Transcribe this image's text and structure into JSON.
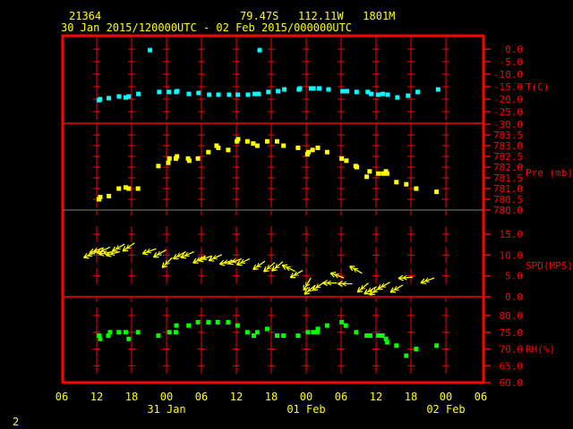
{
  "header": {
    "station": "21364",
    "location": "79.47S   112.11W   1801M",
    "period": "30 Jan 2015/120000UTC - 02 Feb 2015/000000UTC"
  },
  "page_number": "2",
  "colors": {
    "frame": "#ff0000",
    "axis_text": "#ff0000",
    "time_text": "#ffff00",
    "temperature": "#00ffff",
    "pressure": "#ffff00",
    "wind": "#ffff00",
    "humidity": "#00ff00"
  },
  "chart_data": {
    "type": "scatter",
    "year": 2015,
    "x_axis": {
      "range": [
        "30 Jan 06:00",
        "02 Feb 06:00"
      ],
      "tick_labels": [
        "06",
        "12",
        "18",
        "00",
        "06",
        "12",
        "18",
        "00",
        "06",
        "12",
        "18",
        "00",
        "06"
      ],
      "date_labels": [
        {
          "label": "31 Jan",
          "at": "31 Jan 00:00"
        },
        {
          "label": "01 Feb",
          "at": "01 Feb 00:00"
        },
        {
          "label": "02 Feb",
          "at": "02 Feb 00:00"
        }
      ]
    },
    "panels": [
      {
        "id": "temperature",
        "ylabel": "T(C)",
        "ylim": [
          -30,
          0
        ],
        "color": "#00ffff",
        "ticks": [
          "0.0",
          "-5.0",
          "-10.0",
          "-15.0",
          "-20.0",
          "-25.0",
          "-30.0"
        ],
        "points": [
          [
            "30 Jan 12:25",
            -20.4
          ],
          [
            "30 Jan 12:35",
            -20.0
          ],
          [
            "30 Jan 14:05",
            -19.6
          ],
          [
            "30 Jan 15:50",
            -18.9
          ],
          [
            "30 Jan 17:00",
            -19.3
          ],
          [
            "30 Jan 17:30",
            -18.9
          ],
          [
            "30 Jan 19:10",
            -17.9
          ],
          [
            "30 Jan 21:10",
            -0.4
          ],
          [
            "30 Jan 22:45",
            -17.1
          ],
          [
            "31 Jan 00:25",
            -17.1
          ],
          [
            "31 Jan 01:40",
            -17.1
          ],
          [
            "31 Jan 01:50",
            -16.8
          ],
          [
            "31 Jan 03:50",
            -17.9
          ],
          [
            "31 Jan 05:30",
            -17.5
          ],
          [
            "31 Jan 07:20",
            -18.2
          ],
          [
            "31 Jan 08:55",
            -18.2
          ],
          [
            "31 Jan 10:45",
            -18.2
          ],
          [
            "31 Jan 12:15",
            -18.2
          ],
          [
            "31 Jan 14:00",
            -18.2
          ],
          [
            "31 Jan 15:10",
            -17.9
          ],
          [
            "31 Jan 15:50",
            -17.9
          ],
          [
            "31 Jan 16:00",
            -0.4
          ],
          [
            "31 Jan 17:30",
            -17.1
          ],
          [
            "31 Jan 19:10",
            -16.8
          ],
          [
            "31 Jan 20:15",
            -16.1
          ],
          [
            "31 Jan 22:45",
            -16.1
          ],
          [
            "31 Jan 22:55",
            -15.7
          ],
          [
            "01 Feb 00:50",
            -15.7
          ],
          [
            "01 Feb 01:15",
            -15.7
          ],
          [
            "01 Feb 02:15",
            -15.7
          ],
          [
            "01 Feb 03:50",
            -16.1
          ],
          [
            "01 Feb 06:15",
            -16.8
          ],
          [
            "01 Feb 07:00",
            -16.8
          ],
          [
            "01 Feb 08:40",
            -17.1
          ],
          [
            "01 Feb 10:35",
            -17.1
          ],
          [
            "01 Feb 11:10",
            -17.9
          ],
          [
            "01 Feb 12:25",
            -18.2
          ],
          [
            "01 Feb 13:10",
            -17.9
          ],
          [
            "01 Feb 14:00",
            -18.2
          ],
          [
            "01 Feb 15:40",
            -19.3
          ],
          [
            "01 Feb 17:30",
            -18.6
          ],
          [
            "01 Feb 19:10",
            -17.1
          ],
          [
            "01 Feb 22:40",
            -16.1
          ]
        ]
      },
      {
        "id": "pressure",
        "ylabel": "Pre (mb)",
        "ylim": [
          780,
          783.5
        ],
        "color": "#ffff00",
        "ticks": [
          "783.5",
          "783.0",
          "782.5",
          "782.0",
          "781.5",
          "781.0",
          "780.5",
          "780.0"
        ],
        "points": [
          [
            "30 Jan 12:24",
            780.5
          ],
          [
            "30 Jan 12:36",
            780.6
          ],
          [
            "30 Jan 14:06",
            780.65
          ],
          [
            "30 Jan 15:48",
            781.0
          ],
          [
            "30 Jan 17:00",
            781.05
          ],
          [
            "30 Jan 17:30",
            781.0
          ],
          [
            "30 Jan 19:06",
            781.0
          ],
          [
            "30 Jan 22:36",
            782.05
          ],
          [
            "31 Jan 00:18",
            782.2
          ],
          [
            "31 Jan 00:30",
            782.4
          ],
          [
            "31 Jan 01:36",
            782.4
          ],
          [
            "31 Jan 01:48",
            782.5
          ],
          [
            "31 Jan 03:42",
            782.4
          ],
          [
            "31 Jan 03:54",
            782.3
          ],
          [
            "31 Jan 05:24",
            782.4
          ],
          [
            "31 Jan 07:12",
            782.7
          ],
          [
            "31 Jan 08:36",
            783.0
          ],
          [
            "31 Jan 08:54",
            782.9
          ],
          [
            "31 Jan 10:36",
            782.8
          ],
          [
            "31 Jan 12:06",
            783.2
          ],
          [
            "31 Jan 12:18",
            783.3
          ],
          [
            "31 Jan 13:54",
            783.2
          ],
          [
            "31 Jan 14:54",
            783.1
          ],
          [
            "31 Jan 15:36",
            783.0
          ],
          [
            "31 Jan 17:18",
            783.2
          ],
          [
            "31 Jan 19:00",
            783.2
          ],
          [
            "31 Jan 20:06",
            783.0
          ],
          [
            "31 Jan 22:36",
            782.9
          ],
          [
            "01 Feb 00:12",
            782.6
          ],
          [
            "01 Feb 00:24",
            782.7
          ],
          [
            "01 Feb 01:06",
            782.8
          ],
          [
            "01 Feb 02:00",
            782.9
          ],
          [
            "01 Feb 03:36",
            782.7
          ],
          [
            "01 Feb 06:06",
            782.4
          ],
          [
            "01 Feb 06:54",
            782.3
          ],
          [
            "01 Feb 08:30",
            782.05
          ],
          [
            "01 Feb 08:42",
            782.0
          ],
          [
            "01 Feb 10:24",
            781.55
          ],
          [
            "01 Feb 10:54",
            781.8
          ],
          [
            "01 Feb 12:24",
            781.7
          ],
          [
            "01 Feb 13:12",
            781.7
          ],
          [
            "01 Feb 13:42",
            781.8
          ],
          [
            "01 Feb 13:54",
            781.7
          ],
          [
            "01 Feb 15:30",
            781.3
          ],
          [
            "01 Feb 17:12",
            781.2
          ],
          [
            "01 Feb 18:54",
            781.0
          ],
          [
            "01 Feb 22:24",
            780.85
          ]
        ]
      },
      {
        "id": "wind",
        "ylabel": "SPD(MPS)",
        "ylim": [
          0,
          15
        ],
        "color": "#ffff00",
        "ticks": [
          "15.0",
          "10.0",
          "5.0",
          "0.0"
        ],
        "points": [
          [
            "30 Jan 12:00",
            10.8,
            65
          ],
          [
            "30 Jan 13:06",
            11.7,
            70
          ],
          [
            "30 Jan 14:18",
            11.9,
            65
          ],
          [
            "30 Jan 14:48",
            10.8,
            80
          ],
          [
            "30 Jan 16:00",
            10.8,
            75
          ],
          [
            "30 Jan 16:48",
            12.6,
            60
          ],
          [
            "30 Jan 18:30",
            12.9,
            55
          ],
          [
            "30 Jan 22:12",
            11.5,
            70
          ],
          [
            "30 Jan 23:54",
            11.2,
            60
          ],
          [
            "31 Jan 01:00",
            9.4,
            45
          ],
          [
            "31 Jan 03:18",
            10.8,
            60
          ],
          [
            "31 Jan 04:42",
            10.8,
            65
          ],
          [
            "31 Jan 06:42",
            9.8,
            60
          ],
          [
            "31 Jan 07:48",
            9.8,
            70
          ],
          [
            "31 Jan 09:30",
            10.1,
            65
          ],
          [
            "31 Jan 11:30",
            8.7,
            75
          ],
          [
            "31 Jan 12:54",
            9.1,
            70
          ],
          [
            "31 Jan 14:18",
            9.1,
            65
          ],
          [
            "31 Jan 16:54",
            8.5,
            55
          ],
          [
            "31 Jan 18:36",
            8.2,
            50
          ],
          [
            "31 Jan 20:00",
            8.4,
            50
          ],
          [
            "31 Jan 22:06",
            6.1,
            115
          ],
          [
            "31 Jan 23:24",
            6.3,
            60
          ],
          [
            "01 Feb 00:48",
            4.5,
            30
          ],
          [
            "01 Feb 01:36",
            2.8,
            50
          ],
          [
            "01 Feb 03:06",
            3.5,
            55
          ],
          [
            "01 Feb 05:18",
            3.3,
            90
          ],
          [
            "01 Feb 06:30",
            4.5,
            110
          ],
          [
            "01 Feb 07:54",
            3.1,
            90
          ],
          [
            "01 Feb 09:36",
            5.6,
            120
          ],
          [
            "01 Feb 10:42",
            3.3,
            50
          ],
          [
            "01 Feb 12:06",
            2.4,
            60
          ],
          [
            "01 Feb 12:54",
            2.4,
            55
          ],
          [
            "01 Feb 14:24",
            3.5,
            60
          ],
          [
            "01 Feb 16:36",
            2.8,
            60
          ],
          [
            "01 Feb 18:18",
            4.7,
            85
          ],
          [
            "01 Feb 22:00",
            4.5,
            70
          ]
        ]
      },
      {
        "id": "humidity",
        "ylabel": "RH(%)",
        "ylim": [
          60,
          80
        ],
        "color": "#00ff00",
        "ticks": [
          "80.0",
          "75.0",
          "70.0",
          "65.0",
          "60.0"
        ],
        "points": [
          [
            "30 Jan 12:24",
            74
          ],
          [
            "30 Jan 12:36",
            73
          ],
          [
            "30 Jan 14:00",
            74
          ],
          [
            "30 Jan 14:18",
            75
          ],
          [
            "30 Jan 15:48",
            75
          ],
          [
            "30 Jan 17:00",
            75
          ],
          [
            "30 Jan 17:30",
            73
          ],
          [
            "30 Jan 19:06",
            75
          ],
          [
            "30 Jan 22:36",
            74
          ],
          [
            "31 Jan 00:30",
            75
          ],
          [
            "31 Jan 01:36",
            75
          ],
          [
            "31 Jan 01:42",
            77
          ],
          [
            "31 Jan 03:48",
            77
          ],
          [
            "31 Jan 05:24",
            78
          ],
          [
            "31 Jan 07:12",
            78
          ],
          [
            "31 Jan 08:48",
            78
          ],
          [
            "31 Jan 10:36",
            78
          ],
          [
            "31 Jan 12:12",
            77
          ],
          [
            "31 Jan 13:54",
            75
          ],
          [
            "31 Jan 15:00",
            74
          ],
          [
            "31 Jan 15:36",
            75
          ],
          [
            "31 Jan 17:18",
            76
          ],
          [
            "31 Jan 19:00",
            74
          ],
          [
            "31 Jan 20:06",
            74
          ],
          [
            "31 Jan 22:36",
            74
          ],
          [
            "01 Feb 00:18",
            75
          ],
          [
            "01 Feb 01:12",
            75
          ],
          [
            "01 Feb 01:54",
            75
          ],
          [
            "01 Feb 02:00",
            76
          ],
          [
            "01 Feb 03:36",
            77
          ],
          [
            "01 Feb 06:06",
            78
          ],
          [
            "01 Feb 06:48",
            77
          ],
          [
            "01 Feb 08:36",
            75
          ],
          [
            "01 Feb 10:24",
            74
          ],
          [
            "01 Feb 11:00",
            74
          ],
          [
            "01 Feb 12:24",
            74
          ],
          [
            "01 Feb 13:06",
            74
          ],
          [
            "01 Feb 13:42",
            73
          ],
          [
            "01 Feb 13:54",
            72
          ],
          [
            "01 Feb 15:30",
            71
          ],
          [
            "01 Feb 17:12",
            68
          ],
          [
            "01 Feb 18:54",
            70
          ],
          [
            "01 Feb 22:24",
            71
          ]
        ]
      }
    ]
  }
}
